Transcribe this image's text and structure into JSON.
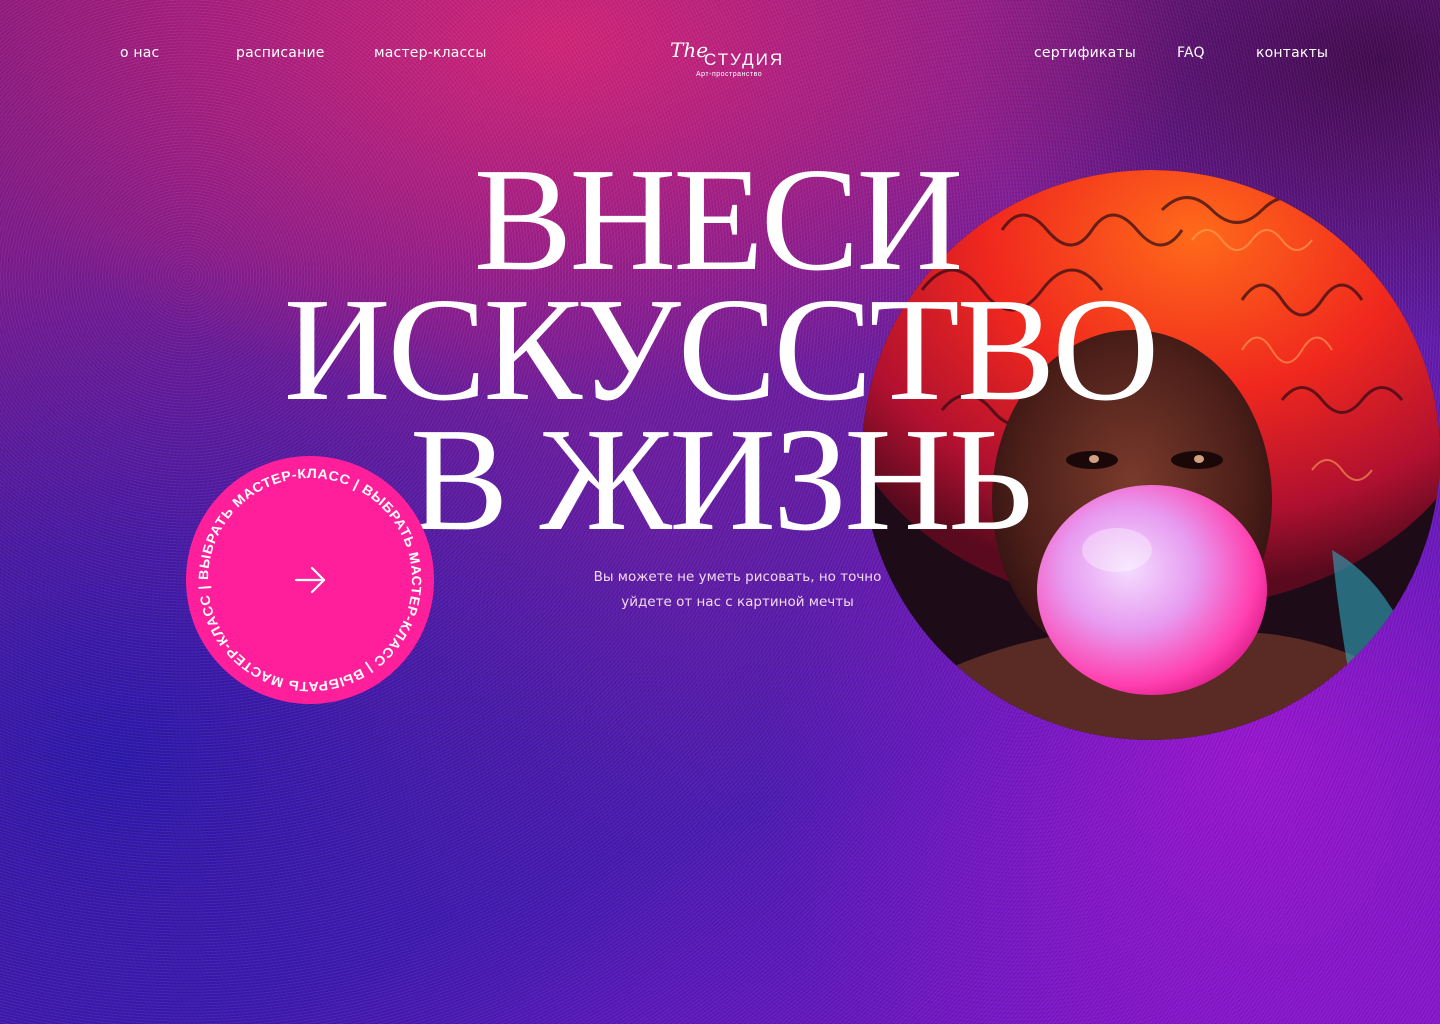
{
  "nav": {
    "left": [
      "о нас",
      "расписание",
      "мастер-классы"
    ],
    "right": [
      "сертификаты",
      "FAQ",
      "контакты"
    ]
  },
  "logo": {
    "prefix": "The",
    "name": "СТУДИЯ",
    "tagline": "Арт-пространство"
  },
  "hero": {
    "line1": "ВНЕСИ",
    "line2": "ИСКУССТВО",
    "line3": "В ЖИЗНЬ",
    "subtitle_line1": "Вы можете не уметь рисовать, но точно",
    "subtitle_line2": "уйдете от нас с картиной мечты"
  },
  "cta": {
    "ring_text": "ВЫБРАТЬ МАСТЕР-КЛАСС | ВЫБРАТЬ МАСТЕР-КЛАСС | ВЫБРАТЬ МАСТЕР-КЛАСС |",
    "arrow_icon": "arrow-right-icon",
    "color": "#ff1f9a"
  },
  "colors": {
    "accent": "#ff1f9a",
    "bg_magenta": "#d62476",
    "bg_blue": "#2c18aa",
    "bg_violet": "#a014d2"
  }
}
